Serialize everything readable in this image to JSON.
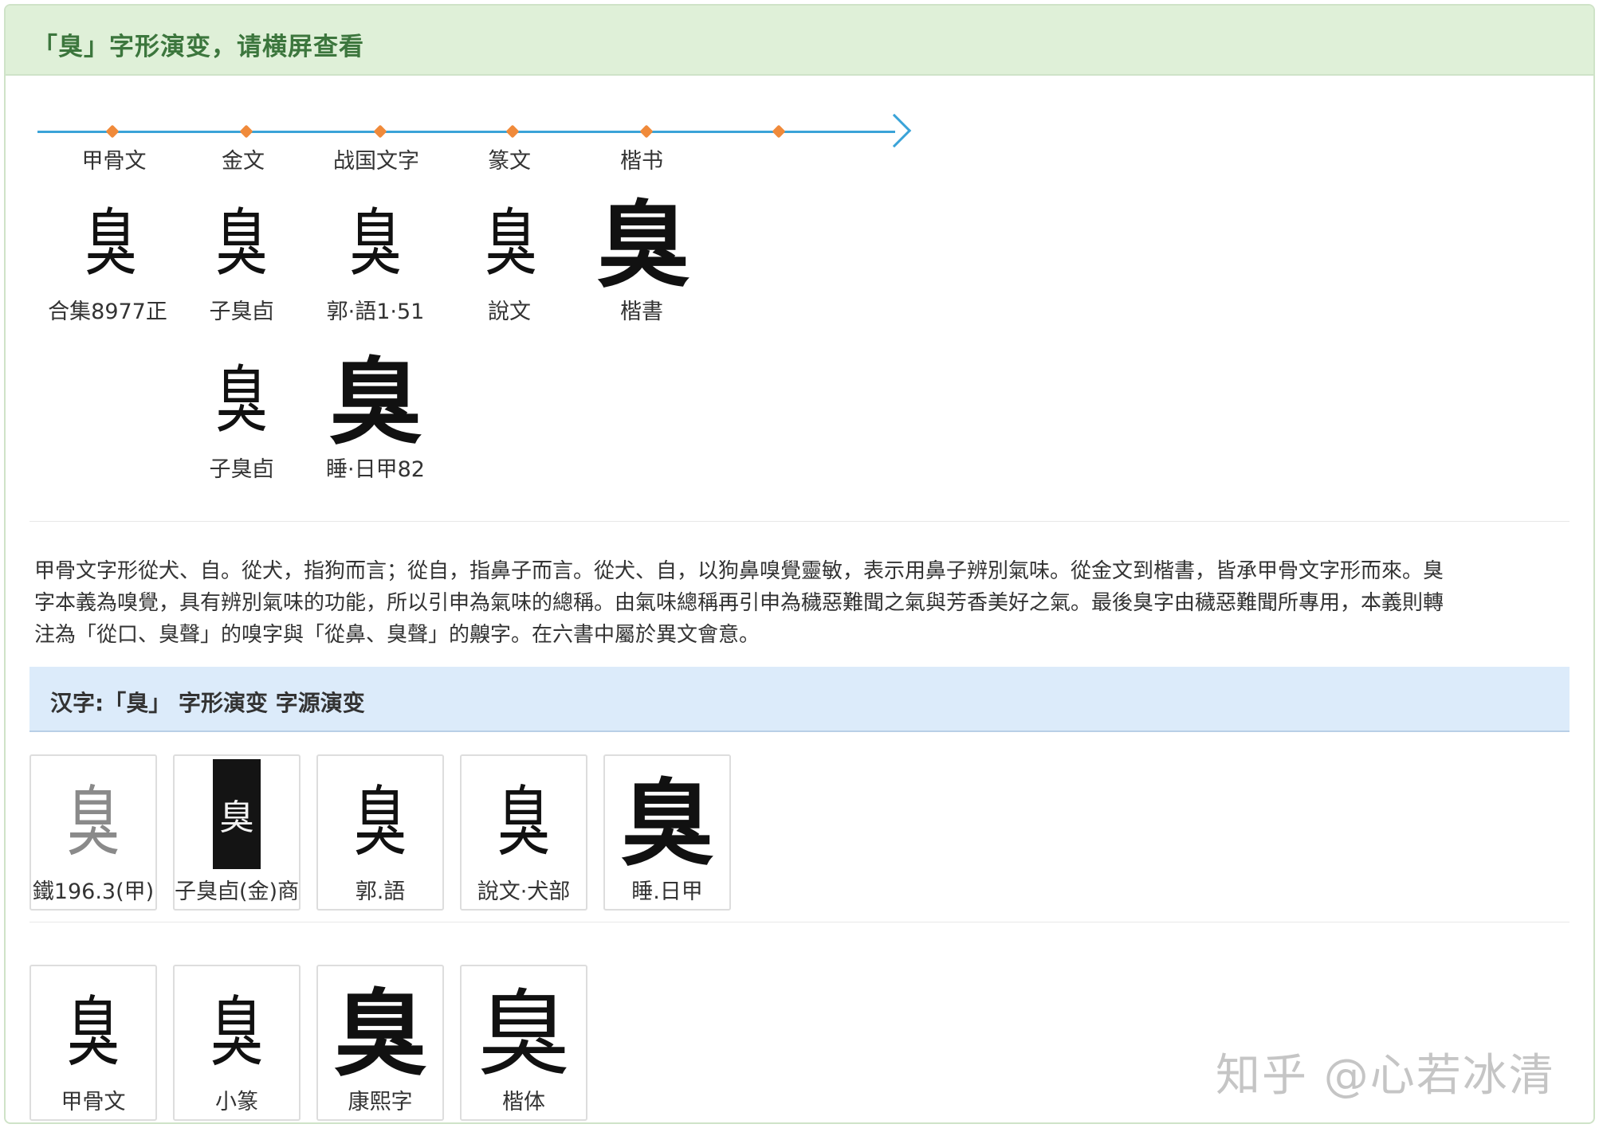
{
  "header": {
    "title": "「臭」字形演变，请横屏查看"
  },
  "timeline": {
    "eras": [
      "甲骨文",
      "金文",
      "战国文字",
      "篆文",
      "楷书"
    ]
  },
  "evolution_row1": [
    {
      "glyph": "臭",
      "source": "合集8977正"
    },
    {
      "glyph": "臭",
      "source": "子臭卣"
    },
    {
      "glyph": "臭",
      "source": "郭·語1·51"
    },
    {
      "glyph": "臭",
      "source": "說文"
    },
    {
      "glyph": "臭",
      "source": "楷書"
    }
  ],
  "evolution_row2": [
    {
      "glyph": "臭",
      "source": "子臭卣"
    },
    {
      "glyph": "臭",
      "source": "睡·日甲82"
    }
  ],
  "paragraph": {
    "line1": "甲骨文字形從犬、自。從犬，指狗而言；從自，指鼻子而言。從犬、自，以狗鼻嗅覺靈敏，表示用鼻子辨別氣味。從金文到楷書，皆承甲骨文字形而來。臭",
    "line2": "字本義為嗅覺，具有辨別氣味的功能，所以引申為氣味的總稱。由氣味總稱再引申為穢惡難聞之氣與芳香美好之氣。最後臭字由穢惡難聞所專用，本義則轉",
    "line3": "注為「從口、臭聲」的嗅字與「從鼻、臭聲」的齅字。在六書中屬於異文會意。"
  },
  "subheader": {
    "title": "汉字:「臭」 字形演变 字源演变"
  },
  "cards_row1": [
    {
      "glyph": "臭",
      "label": "鐵196.3(甲)"
    },
    {
      "glyph": "臭",
      "label": "子臭卣(金)商"
    },
    {
      "glyph": "臭",
      "label": "郭.語"
    },
    {
      "glyph": "臭",
      "label": "說文·犬部"
    },
    {
      "glyph": "臭",
      "label": "睡.日甲"
    }
  ],
  "cards_row2": [
    {
      "glyph": "臭",
      "label": "甲骨文"
    },
    {
      "glyph": "臭",
      "label": "小篆"
    },
    {
      "glyph": "臭",
      "label": "康熙字"
    },
    {
      "glyph": "臭",
      "label": "楷体"
    }
  ],
  "watermark": "知乎 @心若冰清",
  "colors": {
    "header_bg": "#dff0d8",
    "header_text": "#3c763d",
    "timeline_line": "#3aa3d8",
    "timeline_dot": "#f08a3a",
    "subheader_bg": "#dcebfa"
  }
}
